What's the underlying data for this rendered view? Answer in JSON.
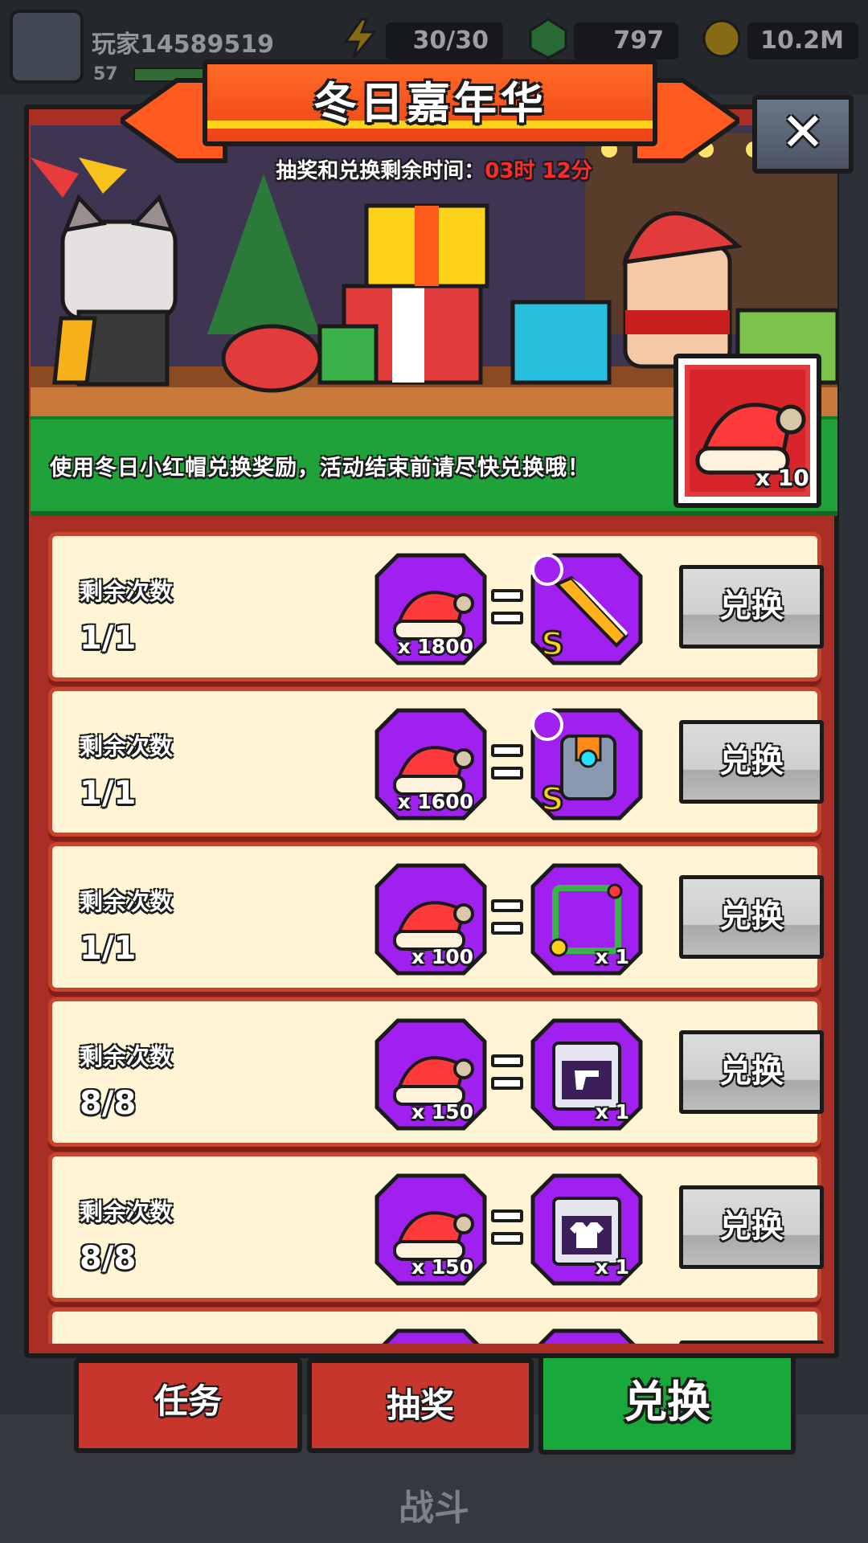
{
  "top_bar": {
    "player_name": "玩家14589519",
    "level": "57",
    "energy": "30/30",
    "gems": "797",
    "coins": "10.2M"
  },
  "event": {
    "title": "冬日嘉年华",
    "timer_label": "抽奖和兑换剩余时间：",
    "timer_value": "03时 12分",
    "description": "使用冬日小红帽兑换奖励，活动结束前请尽快兑换哦！",
    "token_count": "x 10",
    "close_icon": "close-icon"
  },
  "exchange_items": [
    {
      "remaining_label": "剩余次数",
      "remaining": "1/1",
      "cost": "x 1800",
      "reward": "sword",
      "reward_qty": "",
      "button": "兑换"
    },
    {
      "remaining_label": "剩余次数",
      "remaining": "1/1",
      "cost": "x 1600",
      "reward": "armor",
      "reward_qty": "",
      "button": "兑换"
    },
    {
      "remaining_label": "剩余次数",
      "remaining": "1/1",
      "cost": "x 100",
      "reward": "avatar-frame",
      "reward_qty": "x 1",
      "button": "兑换"
    },
    {
      "remaining_label": "剩余次数",
      "remaining": "8/8",
      "cost": "x 150",
      "reward": "weapon-chest",
      "reward_qty": "x 1",
      "button": "兑换"
    },
    {
      "remaining_label": "剩余次数",
      "remaining": "8/8",
      "cost": "x 150",
      "reward": "armor-chest",
      "reward_qty": "x 1",
      "button": "兑换"
    }
  ],
  "tabs": {
    "tasks": "任务",
    "lottery": "抽奖",
    "exchange": "兑换"
  },
  "bottom_nav": {
    "battle": "战斗"
  },
  "colors": {
    "panel_red": "#a82e26",
    "tile_purple": "#a020f0",
    "active_tab_green": "#19a83a"
  }
}
